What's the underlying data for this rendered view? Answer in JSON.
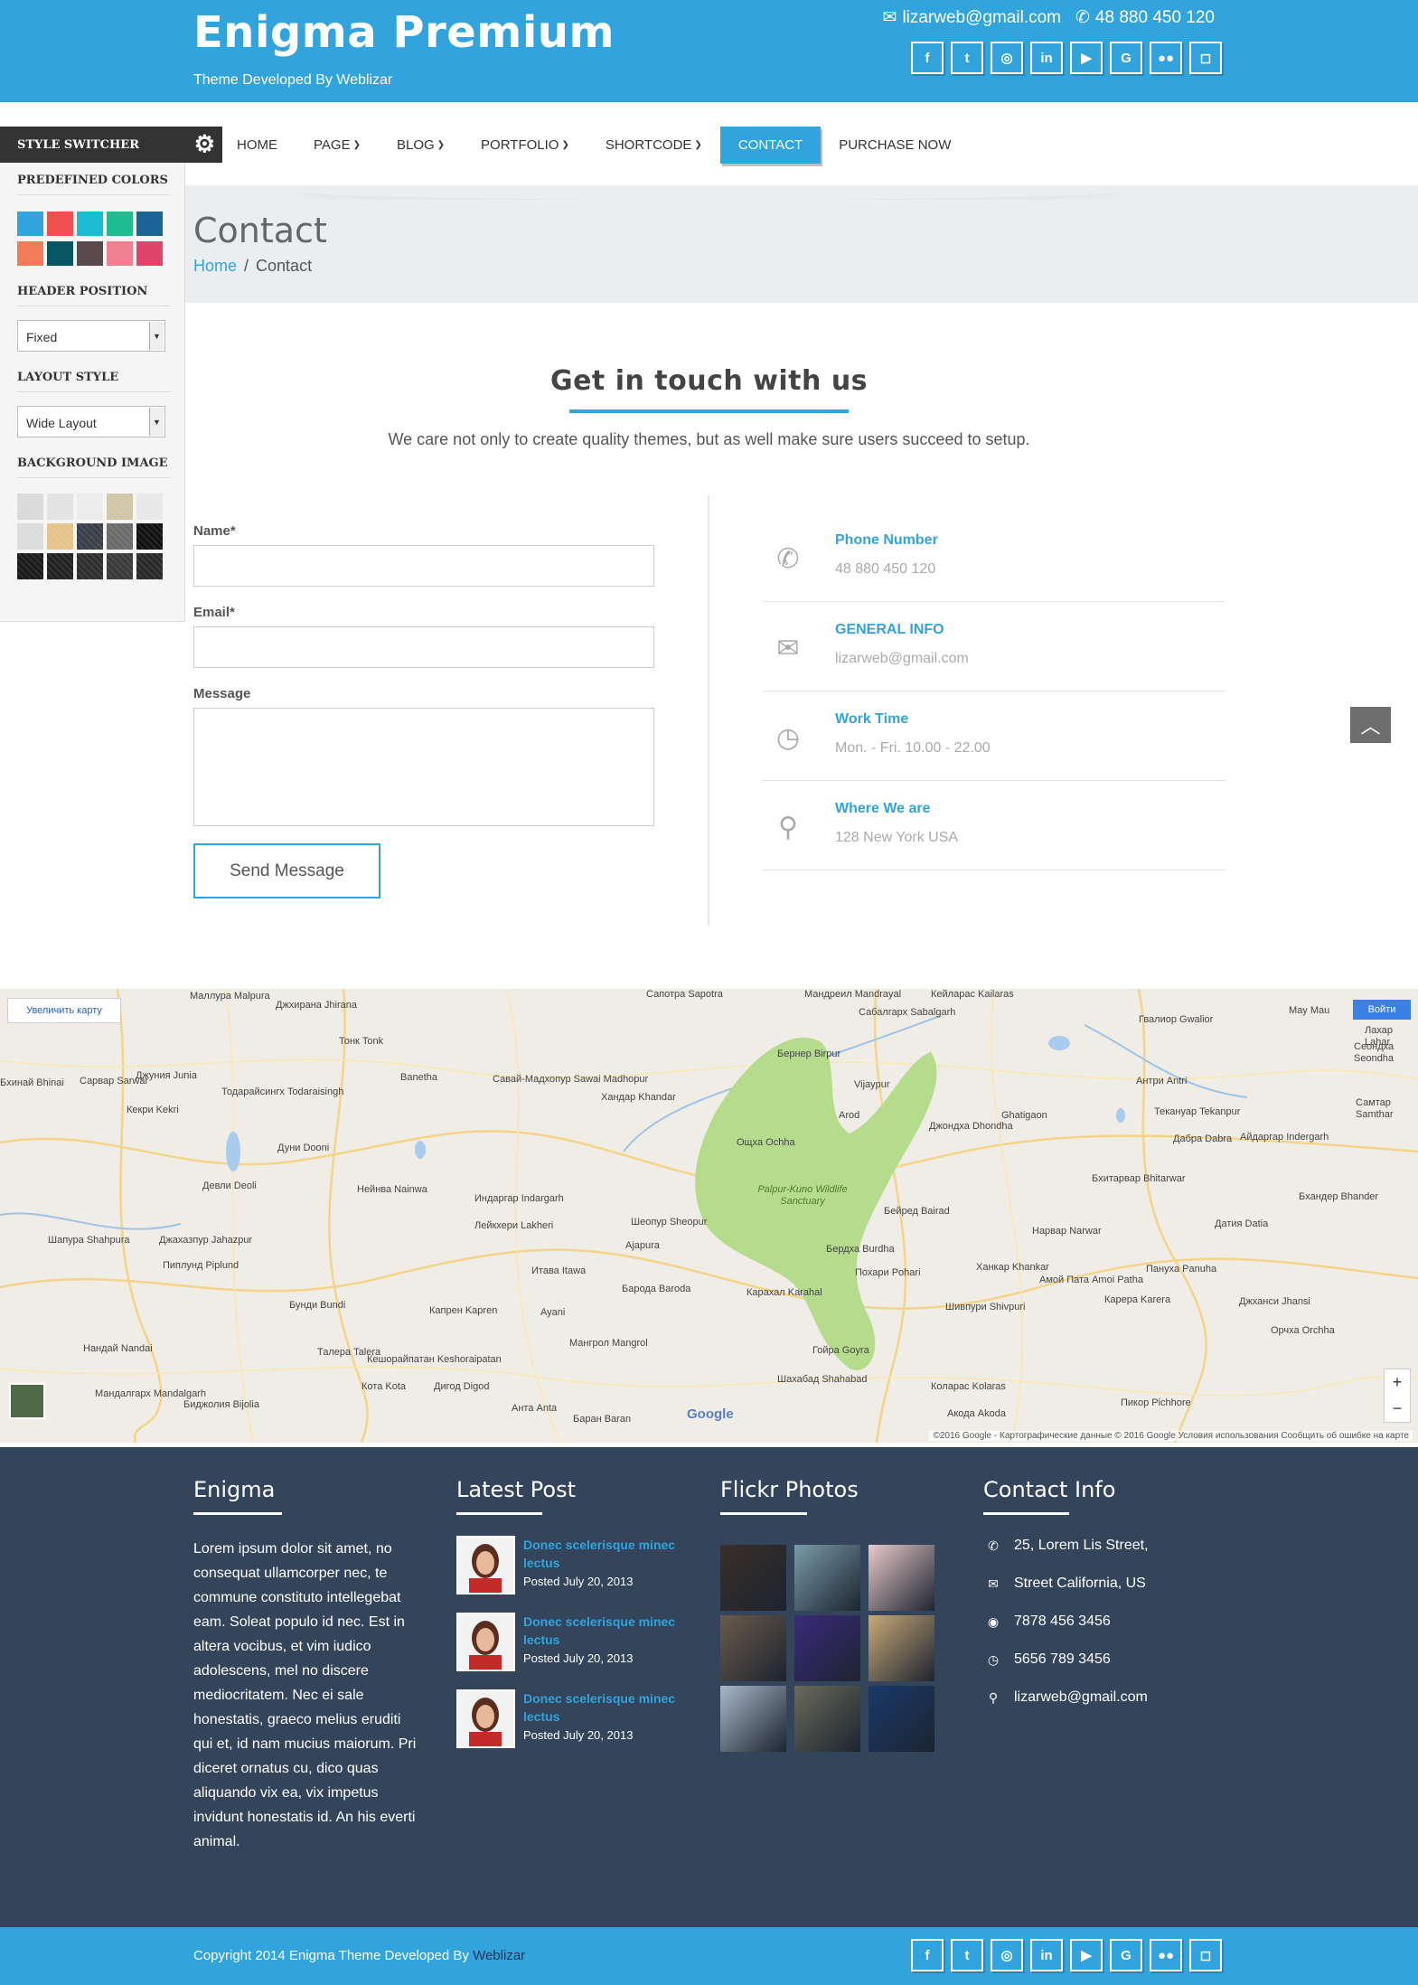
{
  "header": {
    "brand": "Enigma Premium",
    "tagline": "Theme Developed By Weblizar",
    "email": "lizarweb@gmail.com",
    "phone": "48 880 450 120",
    "social": [
      "f",
      "t",
      "◎",
      "in",
      "▶",
      "G",
      "●●",
      "◻"
    ]
  },
  "nav": {
    "items": [
      {
        "label": "HOME"
      },
      {
        "label": "PAGE",
        "dropdown": true
      },
      {
        "label": "BLOG",
        "dropdown": true
      },
      {
        "label": "PORTFOLIO",
        "dropdown": true
      },
      {
        "label": "SHORTCODE",
        "dropdown": true
      },
      {
        "label": "CONTACT",
        "active": true
      },
      {
        "label": "PURCHASE NOW"
      }
    ]
  },
  "page": {
    "title": "Contact",
    "breadcrumb_home": "Home",
    "breadcrumb_sep": "/",
    "breadcrumb_current": "Contact"
  },
  "switcher": {
    "title": "STYLE SWITCHER",
    "predefined_label": "PREDEFINED COLORS",
    "colors": [
      "#31a3dd",
      "#f0504f",
      "#1bbbd1",
      "#1fbc8f",
      "#1a6496",
      "#f47b57",
      "#065663",
      "#5a4a4e",
      "#f08090",
      "#e1436b"
    ],
    "header_label": "HEADER POSITION",
    "header_value": "Fixed",
    "layout_label": "LAYOUT STYLE",
    "layout_value": "Wide Layout",
    "bg_label": "BACKGROUND IMAGE",
    "bg_tiles": [
      "#d9d9d9",
      "#e2e2e2",
      "#ececec",
      "#cfc6a8",
      "#e8e8e8",
      "#dcdcdc",
      "#e6c38a",
      "#3a3f4a",
      "#6a6a6a",
      "#111111",
      "#1a1a1a",
      "#222222",
      "#2e2e2e",
      "#3a3a3a",
      "#2a2a2a"
    ]
  },
  "contact": {
    "heading": "Get in touch with us",
    "subheading": "We care not only to create quality themes, but as well make sure users succeed to setup.",
    "name_label": "Name*",
    "email_label": "Email*",
    "message_label": "Message",
    "send_label": "Send Message",
    "info": [
      {
        "icon": "phone-icon",
        "glyph": "✆",
        "title": "Phone Number",
        "value": "48 880 450 120"
      },
      {
        "icon": "envelope-icon",
        "glyph": "✉",
        "title": "GENERAL INFO",
        "value": "lizarweb@gmail.com"
      },
      {
        "icon": "clock-icon",
        "glyph": "◷",
        "title": "Work Time",
        "value": "Mon. - Fri. 10.00 - 22.00"
      },
      {
        "icon": "map-marker-icon",
        "glyph": "⚲",
        "title": "Where We are",
        "value": "128 New York USA"
      }
    ]
  },
  "map": {
    "enlarge": "Увеличить карту",
    "login": "Войти",
    "zoom_in": "+",
    "zoom_out": "−",
    "google": "Google",
    "copyright": "©2016 Google - Картографические данные © 2016 Google   Условия использования   Сообщить об ошибке на карте",
    "park": "Palpur-Kuno Wildlife Sanctuary",
    "labels": [
      {
        "t": "Маллура Malpura"
      },
      {
        "t": "Джхирана Jhirana"
      },
      {
        "t": "Тонк Tonk"
      },
      {
        "t": "Джуния Junia"
      },
      {
        "t": "Сарвар Sarwar"
      },
      {
        "t": "Бхинай Bhinai"
      },
      {
        "t": "Кекри Kekri"
      },
      {
        "t": "Тодарайсингх Todaraisingh"
      },
      {
        "t": "Banetha"
      },
      {
        "t": "Савай-Мадхопур Sawai Madhopur"
      },
      {
        "t": "Хандар Khandar"
      },
      {
        "t": "Бернер Birpur"
      },
      {
        "t": "Vijaypur"
      },
      {
        "t": "Сабалгарх Sabalgarh"
      },
      {
        "t": "Гвалиор Gwalior"
      },
      {
        "t": "Антри Antri"
      },
      {
        "t": "Дуни Dooni"
      },
      {
        "t": "Arod"
      },
      {
        "t": "Ощха Ochha"
      },
      {
        "t": "Джондха Dhondha"
      },
      {
        "t": "Ghatigaon"
      },
      {
        "t": "Текануар Tekanpur"
      },
      {
        "t": "Дабра Dabra"
      },
      {
        "t": "Айдаргар Indergarh"
      },
      {
        "t": "Девли Deoli"
      },
      {
        "t": "Нейнва Nainwa"
      },
      {
        "t": "Индаргар Indargarh"
      },
      {
        "t": "Лейкхери Lakheri"
      },
      {
        "t": "Шеопур Sheopur"
      },
      {
        "t": "Ajapura"
      },
      {
        "t": "Бейред Bairad"
      },
      {
        "t": "Бхитарвар Bhitarwar"
      },
      {
        "t": "Шапура Shahpura"
      },
      {
        "t": "Джахазпур Jahazpur"
      },
      {
        "t": "Пиплунд Piplund"
      },
      {
        "t": "Итава Itawa"
      },
      {
        "t": "Барода Baroda"
      },
      {
        "t": "Бердха Burdha"
      },
      {
        "t": "Похари Pohari"
      },
      {
        "t": "Нарвар Narwar"
      },
      {
        "t": "Датия Datia"
      },
      {
        "t": "Бхандер Bhander"
      },
      {
        "t": "Бунди Bundi"
      },
      {
        "t": "Капрен Kapren"
      },
      {
        "t": "Ayani"
      },
      {
        "t": "Карахал Karahal"
      },
      {
        "t": "Ханкар Khankar"
      },
      {
        "t": "Амой Пата Amoi Patha"
      },
      {
        "t": "Пануха Panuha"
      },
      {
        "t": "Шивпури Shivpuri"
      },
      {
        "t": "Карера Karera"
      },
      {
        "t": "Джханси Jhansi"
      },
      {
        "t": "Орчха Orchha"
      },
      {
        "t": "Нандай Nandai"
      },
      {
        "t": "Талера Talera"
      },
      {
        "t": "Кешорайпатан Keshoraipatan"
      },
      {
        "t": "Мангрол Mangrol"
      },
      {
        "t": "Гойра Goyra"
      },
      {
        "t": "Кота Kota"
      },
      {
        "t": "Дигод Digod"
      },
      {
        "t": "Шахабад Shahabad"
      },
      {
        "t": "Коларас Kolaras"
      },
      {
        "t": "Пикор Pichhore"
      },
      {
        "t": "Мандалгарх Mandalgarh"
      },
      {
        "t": "Биджолия Bijolia"
      },
      {
        "t": "Анта Anta"
      },
      {
        "t": "Акода Akoda"
      },
      {
        "t": "Барaн Baran"
      },
      {
        "t": "Мау Mau"
      },
      {
        "t": "Сеондха Seondha"
      },
      {
        "t": "Самтар Samthar"
      },
      {
        "t": "Мандреил Mandrayal"
      },
      {
        "t": "Сапотра Sapotra"
      },
      {
        "t": "Кейларас Kailaras"
      },
      {
        "t": "Лахар Lahar"
      }
    ]
  },
  "footer": {
    "about_title": "Enigma",
    "about_text": "Lorem ipsum dolor sit amet, no consequat ullamcorper nec, te commune constituto intellegebat eam. Soleat populo id nec. Est in altera vocibus, et vim iudico adolescens, mel no discere mediocritatem. Nec ei sale honestatis, graeco melius eruditi qui et, id nam mucius maiorum. Pri diceret ornatus cu, dico quas aliquando vix ea, vix impetus invidunt honestatis id. An his everti animal.",
    "posts_title": "Latest Post",
    "posts": [
      {
        "title": "Donec scelerisque minec lectus",
        "date": "Posted July 20, 2013"
      },
      {
        "title": "Donec scelerisque minec lectus",
        "date": "Posted July 20, 2013"
      },
      {
        "title": "Donec scelerisque minec lectus",
        "date": "Posted July 20, 2013"
      }
    ],
    "flickr_title": "Flickr Photos",
    "flickr_colors": [
      "#3a2e28",
      "#7a9aa8",
      "#e8c9c9",
      "#6a5a4a",
      "#3a2a7a",
      "#c8a878",
      "#aab8c8",
      "#6a6a5a",
      "#1a3a6a"
    ],
    "contact_title": "Contact Info",
    "contact": [
      {
        "icon": "phone-icon",
        "glyph": "✆",
        "text": "25, Lorem Lis Street,"
      },
      {
        "icon": "envelope-icon",
        "glyph": "✉",
        "text": "Street California, US"
      },
      {
        "icon": "globe-icon",
        "glyph": "◉",
        "text": "7878 456 3456"
      },
      {
        "icon": "clock-icon",
        "glyph": "◷",
        "text": "5656 789 3456"
      },
      {
        "icon": "map-marker-icon",
        "glyph": "⚲",
        "text": "lizarweb@gmail.com"
      }
    ],
    "copyright": "Copyright 2014 Enigma Theme  Developed By ",
    "developer": "Weblizar"
  }
}
